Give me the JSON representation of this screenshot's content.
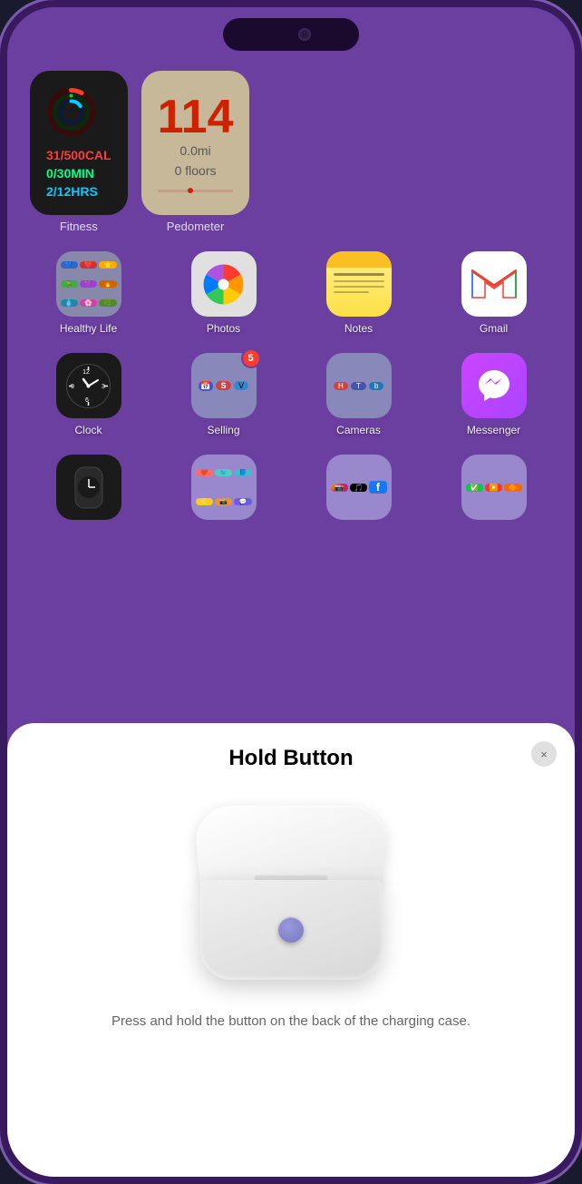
{
  "phone": {
    "background_color": "#6b3fa0"
  },
  "widgets": {
    "fitness": {
      "label": "Fitness",
      "stat1": "31/500CAL",
      "stat2": "0/30MIN",
      "stat3": "2/12HRS"
    },
    "pedometer": {
      "label": "Pedometer",
      "steps": "114",
      "miles": "0.0mi",
      "floors": "0 floors"
    }
  },
  "apps_row1": [
    {
      "id": "healthy-life",
      "name": "Healthy Life",
      "icon_type": "healthy-life"
    },
    {
      "id": "photos",
      "name": "Photos",
      "icon_type": "photos"
    },
    {
      "id": "notes",
      "name": "Notes",
      "icon_type": "notes"
    },
    {
      "id": "gmail",
      "name": "Gmail",
      "icon_type": "gmail"
    }
  ],
  "apps_row2": [
    {
      "id": "clock",
      "name": "Clock",
      "icon_type": "clock"
    },
    {
      "id": "selling",
      "name": "Selling",
      "icon_type": "selling",
      "badge": "5"
    },
    {
      "id": "cameras",
      "name": "Cameras",
      "icon_type": "cameras"
    },
    {
      "id": "messenger",
      "name": "Messenger",
      "icon_type": "messenger"
    }
  ],
  "apps_row3_partial": [
    {
      "id": "watch",
      "name": "",
      "icon_type": "watch"
    },
    {
      "id": "social1",
      "name": "",
      "icon_type": "social1"
    },
    {
      "id": "social2",
      "name": "",
      "icon_type": "social2"
    },
    {
      "id": "social3",
      "name": "",
      "icon_type": "social3"
    }
  ],
  "modal": {
    "title": "Hold Button",
    "description": "Press and hold the button on the back of the charging case.",
    "close_label": "×"
  }
}
